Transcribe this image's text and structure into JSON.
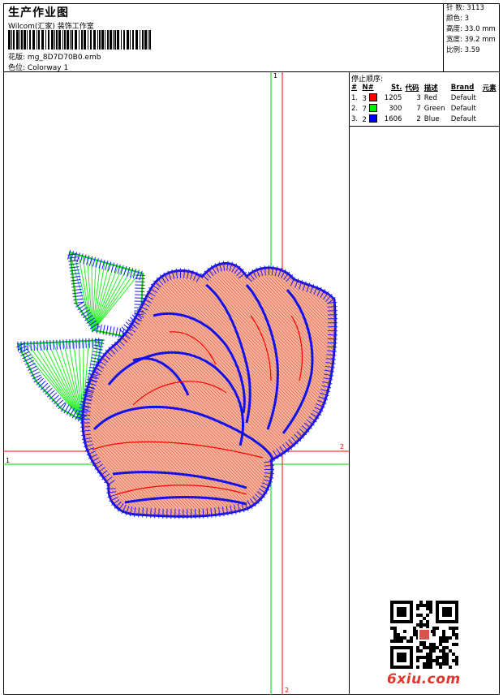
{
  "header": {
    "title": "生产作业图",
    "company": "Wilcom(汇家) 装饰工作室",
    "design_label": "花版:",
    "design_value": "mg_8D7D70B0.emb",
    "colorway_label": "色位:",
    "colorway_value": "Colorway 1"
  },
  "stats": [
    {
      "label": "针 数:",
      "value": "3113"
    },
    {
      "label": "颜色:",
      "value": "3"
    },
    {
      "label": "高度:",
      "value": "33.0 mm"
    },
    {
      "label": "宽度:",
      "value": "39.2 mm"
    },
    {
      "label": "比例:",
      "value": "3.59"
    }
  ],
  "stop_sequence": {
    "title": "停止顺序:",
    "columns": [
      "#",
      "N#",
      "St.",
      "代码",
      "描述",
      "Brand",
      "元素"
    ],
    "rows": [
      {
        "idx": "1.",
        "n": "3",
        "stitches": "1205",
        "code": "3",
        "desc": "Red",
        "brand": "Default",
        "color": "#ff0000"
      },
      {
        "idx": "2.",
        "n": "7",
        "stitches": "300",
        "code": "7",
        "desc": "Green",
        "brand": "Default",
        "color": "#00ee00"
      },
      {
        "idx": "3.",
        "n": "2",
        "stitches": "1606",
        "code": "2",
        "desc": "Blue",
        "brand": "Default",
        "color": "#0000ff"
      }
    ]
  },
  "axis_labels": {
    "green_top": "1",
    "green_left": "1",
    "red_right": "2",
    "red_bottom": "2"
  },
  "watermark": {
    "site": "6xiu.com"
  },
  "colors": {
    "red": "#ff0000",
    "green": "#00dd00",
    "blue": "#0000ff",
    "fill": "#f2b8a0"
  }
}
